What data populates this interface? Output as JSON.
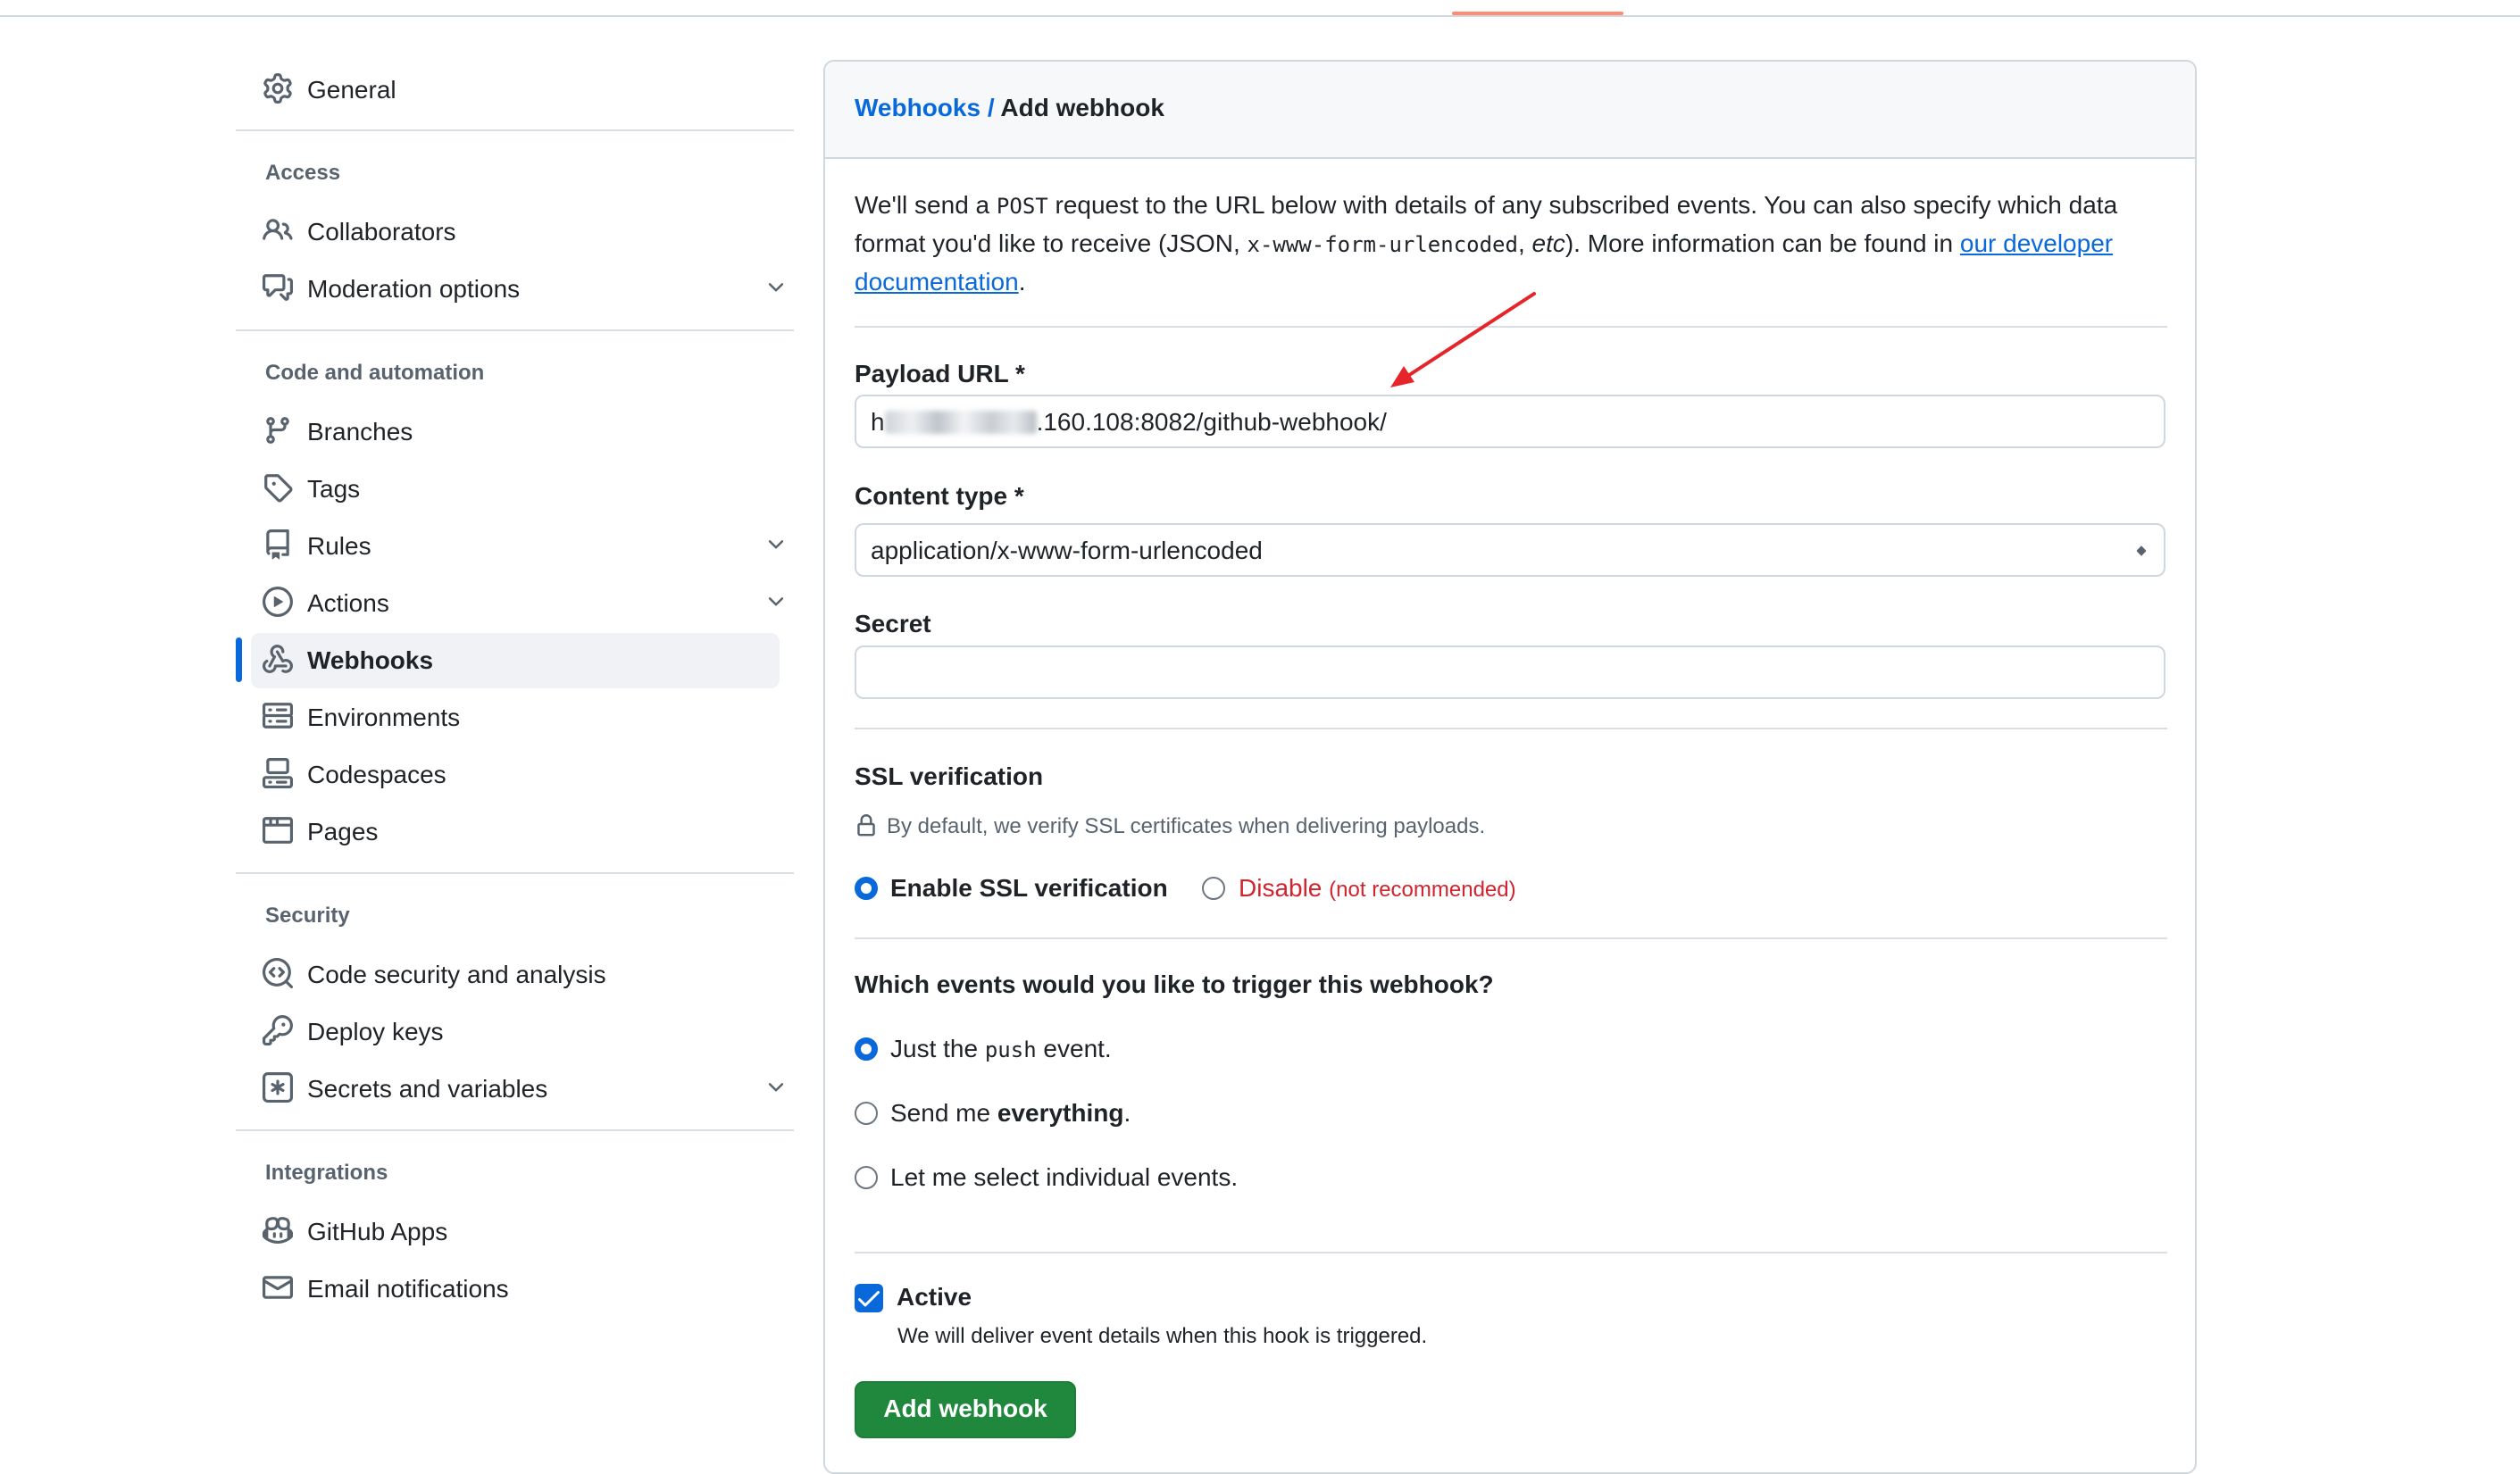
{
  "sidebar": {
    "general": "General",
    "sections": {
      "access": "Access",
      "code_automation": "Code and automation",
      "security": "Security",
      "integrations": "Integrations"
    },
    "items": {
      "collaborators": "Collaborators",
      "moderation": "Moderation options",
      "branches": "Branches",
      "tags": "Tags",
      "rules": "Rules",
      "actions": "Actions",
      "webhooks": "Webhooks",
      "environments": "Environments",
      "codespaces": "Codespaces",
      "pages": "Pages",
      "code_security": "Code security and analysis",
      "deploy_keys": "Deploy keys",
      "secrets": "Secrets and variables",
      "github_apps": "GitHub Apps",
      "email_notifications": "Email notifications"
    },
    "active": "Webhooks"
  },
  "header": {
    "breadcrumb_link": "Webhooks",
    "separator": "/",
    "current": "Add webhook"
  },
  "intro": {
    "p1": "We'll send a ",
    "post": "POST",
    "p2": " request to the URL below with details of any subscribed events. You can also specify which data format you'd like to receive (JSON, ",
    "form_code": "x-www-form-urlencoded",
    "p3": ", ",
    "etc": "etc",
    "p4": "). More information can be found in ",
    "link": "our developer documentation",
    "p5": "."
  },
  "form": {
    "payload_label": "Payload URL *",
    "payload_prefix": "h",
    "payload_value": ".160.108:8082/github-webhook/",
    "content_type_label": "Content type *",
    "content_type_value": "application/x-www-form-urlencoded",
    "secret_label": "Secret",
    "secret_value": ""
  },
  "ssl": {
    "heading": "SSL verification",
    "note": "By default, we verify SSL certificates when delivering payloads.",
    "enable_label": "Enable SSL verification",
    "disable_label": "Disable",
    "disable_note": "(not recommended)",
    "selected": "enable"
  },
  "events": {
    "question": "Which events would you like to trigger this webhook?",
    "opt1_pre": "Just the ",
    "opt1_code": "push",
    "opt1_post": " event.",
    "opt2_pre": "Send me ",
    "opt2_bold": "everything",
    "opt2_post": ".",
    "opt3": "Let me select individual events.",
    "selected": "push"
  },
  "active": {
    "label": "Active",
    "description": "We will deliver event details when this hook is triggered.",
    "checked": true
  },
  "submit_label": "Add webhook",
  "colors": {
    "accent": "#0969da",
    "primary_button": "#1f883d",
    "danger": "#d1242f",
    "annotation_arrow": "#e5252a"
  }
}
